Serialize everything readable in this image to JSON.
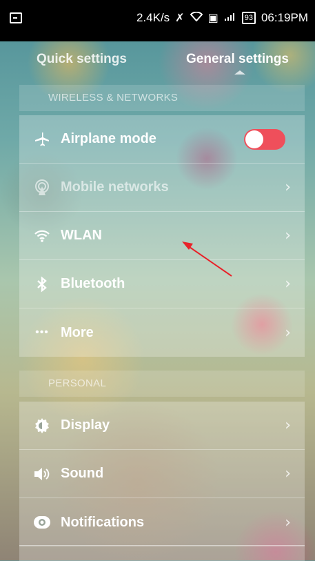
{
  "status": {
    "speed": "2.4K/s",
    "battery": "93",
    "time": "06:19PM"
  },
  "tabs": {
    "quick": "Quick settings",
    "general": "General settings"
  },
  "sections": {
    "wireless": "WIRELESS & NETWORKS",
    "personal": "PERSONAL"
  },
  "wireless_items": [
    {
      "label": "Airplane mode",
      "icon": "airplane-icon"
    },
    {
      "label": "Mobile networks",
      "icon": "mobile-network-icon"
    },
    {
      "label": "WLAN",
      "icon": "wifi-icon"
    },
    {
      "label": "Bluetooth",
      "icon": "bluetooth-icon"
    },
    {
      "label": "More",
      "icon": "more-icon"
    }
  ],
  "personal_items": [
    {
      "label": "Display",
      "icon": "display-gear-icon"
    },
    {
      "label": "Sound",
      "icon": "speaker-icon"
    },
    {
      "label": "Notifications",
      "icon": "notification-icon"
    }
  ],
  "colors": {
    "toggle_on": "#ef4f5b",
    "annotation_arrow": "#e8232a"
  }
}
